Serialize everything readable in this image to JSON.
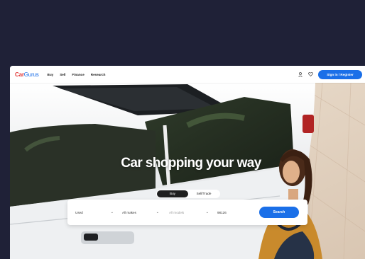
{
  "header": {
    "logo_part1": "Car",
    "logo_part2": "Gurus",
    "nav": [
      "Buy",
      "Sell",
      "Finance",
      "Research"
    ],
    "signin_label": "Sign in / Register"
  },
  "hero": {
    "headline": "Car shopping your way"
  },
  "search": {
    "tabs": [
      {
        "label": "Buy",
        "active": true
      },
      {
        "label": "Sell/Trade",
        "active": false
      }
    ],
    "condition": "Used",
    "make": "All makes",
    "model_placeholder": "All models",
    "zip": "98126",
    "button": "Search"
  },
  "colors": {
    "background": "#1f2137",
    "accent": "#1a6fe8",
    "logo_red": "#e23b3b"
  }
}
